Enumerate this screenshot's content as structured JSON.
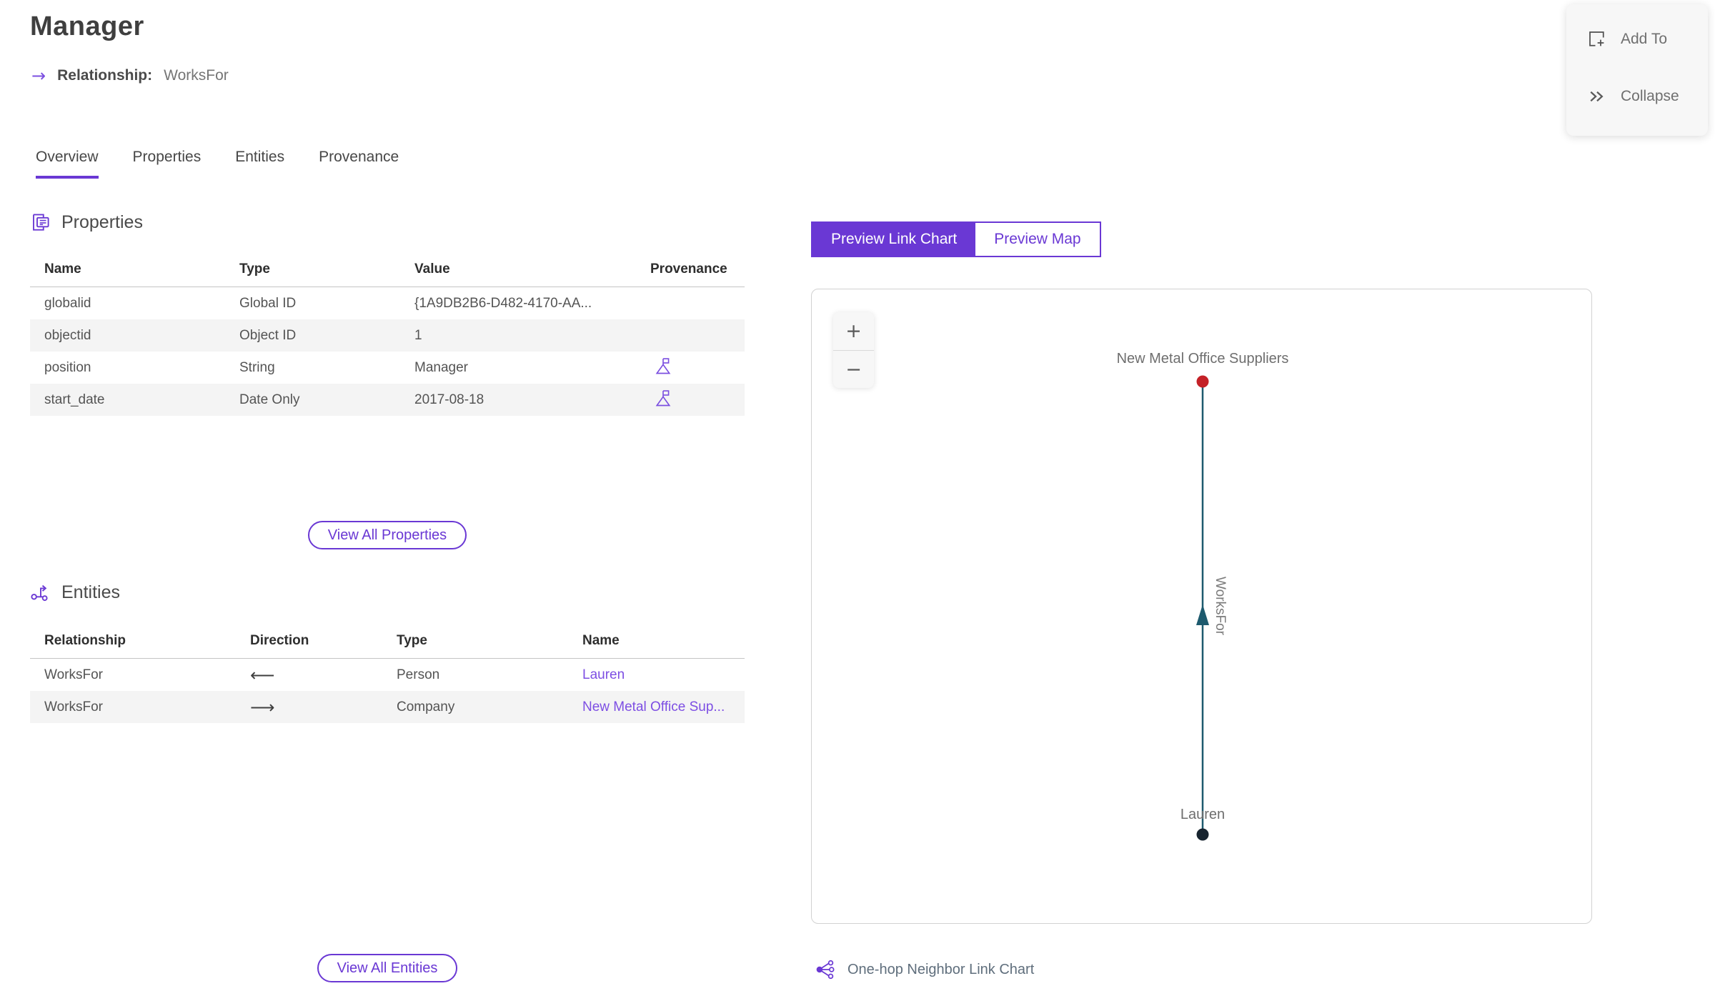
{
  "header": {
    "title": "Manager",
    "arrow_glyph": "→",
    "subtitle_label": "Relationship:",
    "subtitle_value": "WorksFor"
  },
  "actions_panel": {
    "add_to_label": "Add To",
    "collapse_label": "Collapse"
  },
  "tabs": [
    {
      "label": "Overview"
    },
    {
      "label": "Properties"
    },
    {
      "label": "Entities"
    },
    {
      "label": "Provenance"
    }
  ],
  "properties_section": {
    "title": "Properties",
    "columns": {
      "name": "Name",
      "type": "Type",
      "value": "Value",
      "provenance": "Provenance"
    },
    "rows": [
      {
        "name": "globalid",
        "type": "Global ID",
        "value": "{1A9DB2B6-D482-4170-AA..."
      },
      {
        "name": "objectid",
        "type": "Object ID",
        "value": "1"
      },
      {
        "name": "position",
        "type": "String",
        "value": "Manager"
      },
      {
        "name": "start_date",
        "type": "Date Only",
        "value": "2017-08-18"
      }
    ],
    "view_all_label": "View All Properties"
  },
  "entities_section": {
    "title": "Entities",
    "columns": {
      "relationship": "Relationship",
      "direction": "Direction",
      "type": "Type",
      "name": "Name"
    },
    "rows": [
      {
        "relationship": "WorksFor",
        "direction": "⟵",
        "type": "Person",
        "name": "Lauren"
      },
      {
        "relationship": "WorksFor",
        "direction": "⟶",
        "type": "Company",
        "name": "New Metal Office Sup..."
      }
    ],
    "view_all_label": "View All Entities"
  },
  "preview": {
    "tabs": {
      "link_chart": "Preview Link Chart",
      "map": "Preview Map"
    },
    "zoom_in_glyph": "+",
    "zoom_out_glyph": "−",
    "caption": "One-hop Neighbor Link Chart",
    "link_chart": {
      "type": "link-chart",
      "nodes": [
        {
          "label": "New Metal Office Suppliers",
          "color": "#c42127"
        },
        {
          "label": "Lauren",
          "color": "#17242f"
        }
      ],
      "edge": {
        "label": "WorksFor",
        "from": "Lauren",
        "to": "New Metal Office Suppliers",
        "color": "#1d5a6e",
        "arrow_direction": "up"
      }
    }
  },
  "colors": {
    "accent_purple": "#6a38d4",
    "link_purple": "#7d4ee3",
    "node_red": "#c42127",
    "node_dark": "#17242f",
    "edge_teal": "#1d5a6e",
    "row_alt_bg": "#f4f4f4"
  }
}
